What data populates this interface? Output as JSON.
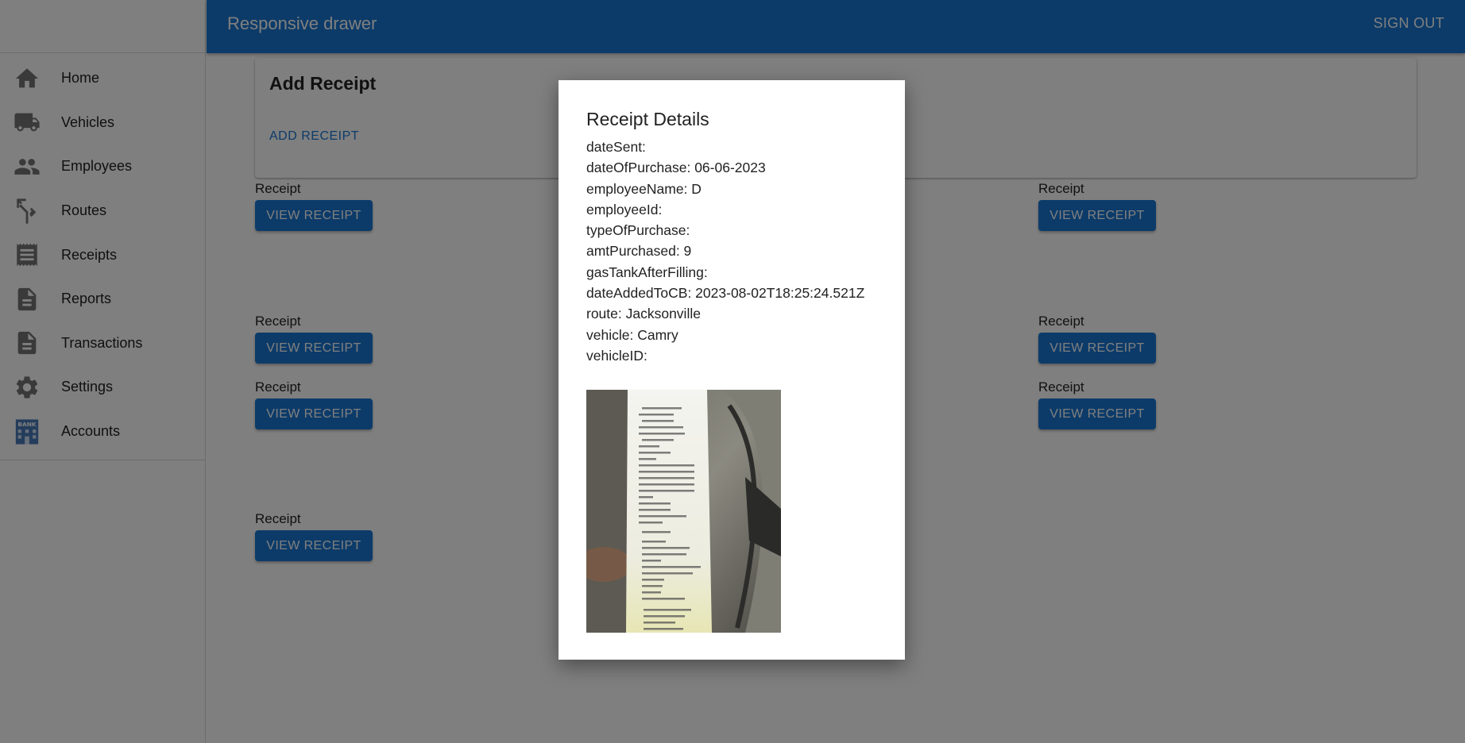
{
  "app": {
    "title": "Responsive drawer",
    "sign_out_label": "SIGN OUT"
  },
  "sidebar": {
    "items": [
      {
        "label": "Home",
        "icon": "home-icon"
      },
      {
        "label": "Vehicles",
        "icon": "truck-icon"
      },
      {
        "label": "Employees",
        "icon": "people-icon"
      },
      {
        "label": "Routes",
        "icon": "fork-icon"
      },
      {
        "label": "Receipts",
        "icon": "receipt-icon"
      },
      {
        "label": "Reports",
        "icon": "document-icon"
      },
      {
        "label": "Transactions",
        "icon": "document-icon"
      },
      {
        "label": "Settings",
        "icon": "gear-icon"
      },
      {
        "label": "Accounts",
        "icon": "bank-icon",
        "icon_text": "BANK"
      }
    ]
  },
  "add_card": {
    "title": "Add Receipt",
    "button_label": "ADD RECEIPT"
  },
  "receipts": {
    "label": "Receipt",
    "button_label": "VIEW RECEIPT"
  },
  "modal": {
    "title": "Receipt Details",
    "fields": [
      "dateSent:",
      "dateOfPurchase: 06-06-2023",
      "employeeName: D",
      "employeeId:",
      "typeOfPurchase:",
      "amtPurchased: 9",
      "gasTankAfterFilling:",
      "dateAddedToCB: 2023-08-02T18:25:24.521Z",
      "route: Jacksonville",
      "vehicle: Camry",
      "vehicleID:"
    ]
  },
  "colors": {
    "primary": "#1976d2",
    "icon_gray": "#757575",
    "backdrop": "rgba(0,0,0,0.5)"
  }
}
